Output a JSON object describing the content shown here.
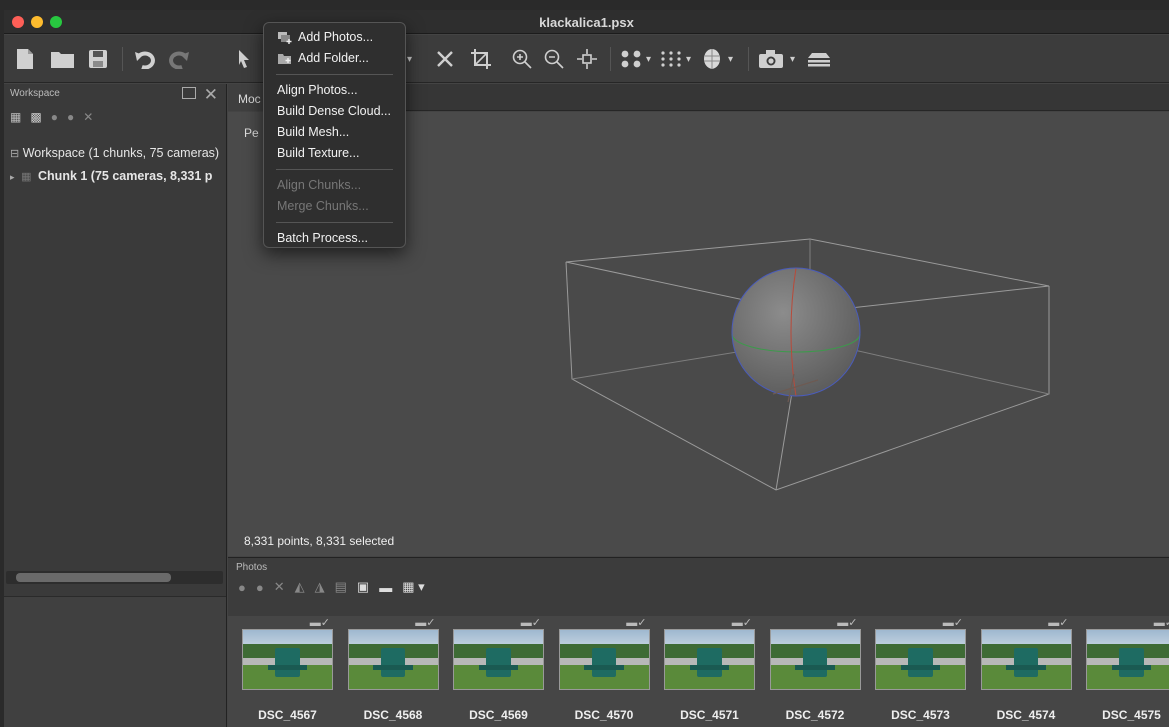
{
  "window": {
    "title": "klackalica1.psx"
  },
  "menu": {
    "items": [
      {
        "label": "Add Photos...",
        "enabled": true,
        "icon": "add-photos-icon"
      },
      {
        "label": "Add Folder...",
        "enabled": true,
        "icon": "add-folder-icon"
      },
      {
        "label": "Align Photos...",
        "enabled": true
      },
      {
        "label": "Build Dense Cloud...",
        "enabled": true
      },
      {
        "label": "Build Mesh...",
        "enabled": true
      },
      {
        "label": "Build Texture...",
        "enabled": true
      },
      {
        "label": "Align Chunks...",
        "enabled": false
      },
      {
        "label": "Merge Chunks...",
        "enabled": false
      },
      {
        "label": "Batch Process...",
        "enabled": true
      }
    ]
  },
  "workspace": {
    "panel_title": "Workspace",
    "root_label": "Workspace (1 chunks, 75 cameras)",
    "chunk_label": "Chunk 1 (75 cameras, 8,331 p"
  },
  "model": {
    "tab_label": "Moc",
    "view_label": "Pe",
    "status": "8,331 points, 8,331 selected"
  },
  "photos": {
    "panel_title": "Photos",
    "items": [
      "DSC_4567",
      "DSC_4568",
      "DSC_4569",
      "DSC_4570",
      "DSC_4571",
      "DSC_4572",
      "DSC_4573",
      "DSC_4574",
      "DSC_4575"
    ]
  },
  "colors": {
    "accent_red": "#fe5f57",
    "accent_yellow": "#febc2e",
    "accent_green": "#28c840"
  }
}
